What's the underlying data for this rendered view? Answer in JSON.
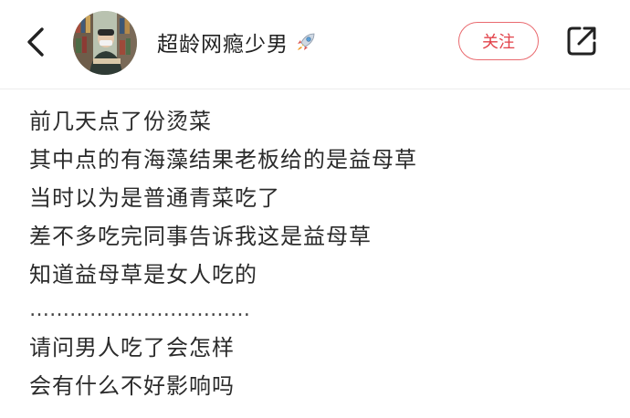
{
  "header": {
    "username": "超龄网瘾少男",
    "username_icon": "rocket-icon",
    "follow_label": "关注",
    "back_icon": "chevron-left-icon",
    "share_icon": "share-icon"
  },
  "post": {
    "lines": [
      "前几天点了份烫菜",
      "其中点的有海藻结果老板给的是益母草",
      "当时以为是普通青菜吃了",
      "差不多吃完同事告诉我这是益母草",
      "知道益母草是女人吃的",
      "……………………………",
      "请问男人吃了会怎样",
      "会有什么不好影响吗"
    ]
  },
  "colors": {
    "accent": "#e2424a",
    "divider": "#ededed",
    "text": "#2b2b2b"
  }
}
